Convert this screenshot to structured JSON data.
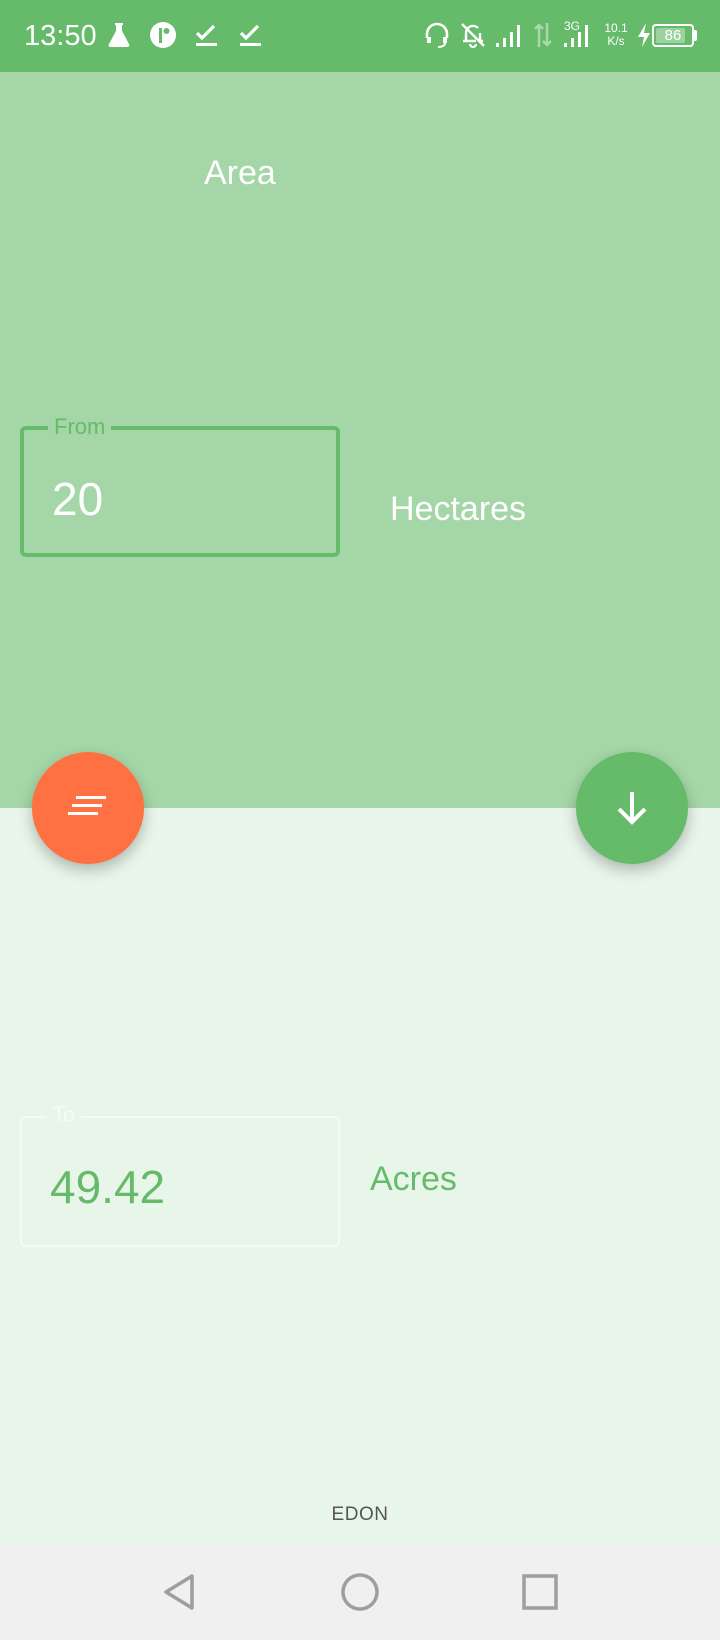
{
  "status_bar": {
    "time": "13:50",
    "net_speed_value": "10.1",
    "net_speed_unit": "K/s",
    "network_type": "3G",
    "battery_level": "86",
    "icons": [
      "flask-icon",
      "pie-app-icon",
      "check-icon",
      "check-icon",
      "headset-icon",
      "bell-off-icon",
      "signal-icon",
      "data-arrows-icon",
      "signal-3g-icon",
      "charging-bolt-icon",
      "battery-icon"
    ]
  },
  "converter": {
    "category": "Area",
    "from": {
      "legend": "From",
      "value": "20",
      "unit": "Hectares"
    },
    "to": {
      "legend": "To",
      "value": "49.42",
      "unit": "Acres"
    }
  },
  "fabs": {
    "menu_icon": "sort-lines-icon",
    "swap_icon": "arrow-down-icon"
  },
  "footer": {
    "brand": "EDON"
  },
  "nav": {
    "buttons": [
      "back-icon",
      "home-icon",
      "recents-icon"
    ]
  },
  "colors": {
    "primary": "#66bb6a",
    "primary_light": "#a5d6a7",
    "background": "#e8f5e9",
    "accent": "#ff7043"
  }
}
